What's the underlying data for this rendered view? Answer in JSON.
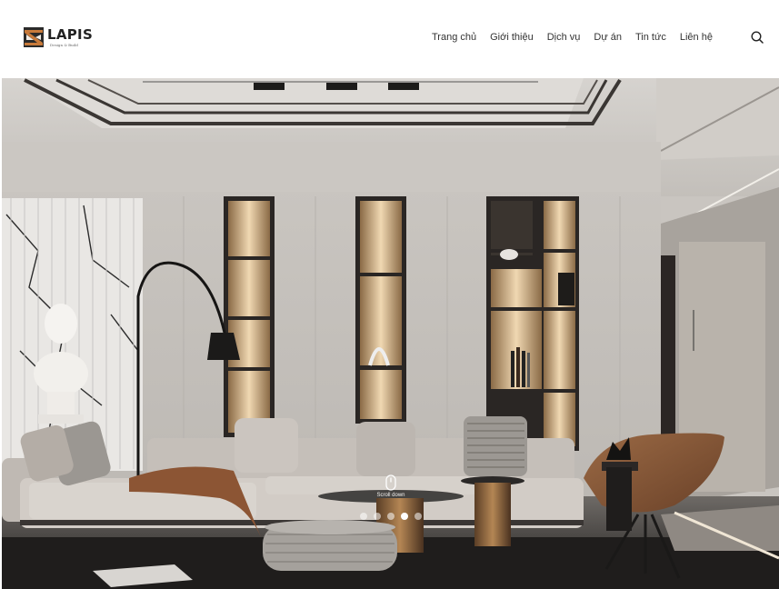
{
  "brand": {
    "name": "LAPIS",
    "tagline": "Design & Build"
  },
  "nav": {
    "items": [
      {
        "label": "Trang chủ"
      },
      {
        "label": "Giới thiệu"
      },
      {
        "label": "Dịch vụ"
      },
      {
        "label": "Dự án"
      },
      {
        "label": "Tin tức"
      },
      {
        "label": "Liên hệ"
      }
    ]
  },
  "search": {
    "icon": "search-icon"
  },
  "hero": {
    "scroll_label": "Scroll down",
    "slides_total": 5,
    "active_slide": 4
  },
  "colors": {
    "text": "#333333",
    "brand_orange": "#c87a3a",
    "hero_wall": "#c9c5c0",
    "dot_active": "#ffffff"
  }
}
